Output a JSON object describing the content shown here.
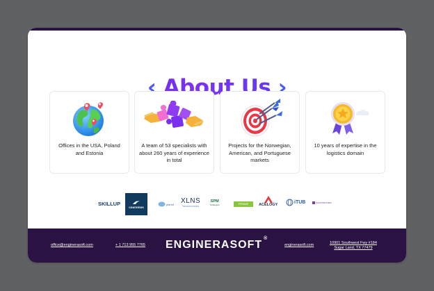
{
  "title": {
    "left_chevron": "‹",
    "text": "About Us",
    "right_chevron": "›"
  },
  "features": [
    {
      "icon": "globe-icon",
      "text": "Offices in the USA, Poland and Estonia"
    },
    {
      "icon": "puzzle-icon",
      "text": "A team of 53 specialists with about 260 years of experience in total"
    },
    {
      "icon": "target-icon",
      "text": "Projects for the Norwegian, American, and Portuguese markets"
    },
    {
      "icon": "medal-icon",
      "text": "10 years of expertise in the logistics domain"
    }
  ],
  "logos": {
    "skillup": "SKILLUP",
    "coursmos": "coursmos",
    "planet": "planet",
    "xlns": "XLNS",
    "xlns_sub": "TECHNOLOGIES",
    "spm": "SPM",
    "spm_sub": "Strategies",
    "green": "PIRAMIS",
    "acelogy": "ACELOGY",
    "itub": "iTUB",
    "paintpartner": "PAINTPARTNER"
  },
  "footer": {
    "email": "office@enginerasoft.com",
    "phone": "+ 1 713 955 7765",
    "brand": "ENGINERASOFT",
    "reg": "®",
    "website": "enginerasoft.com",
    "address_line1": "10901 Southwest Fwy #184",
    "address_line2": "Sugar Land, TX 77479"
  },
  "colors": {
    "accent_purple": "#6a2cf0",
    "footer_bg": "#2a1242",
    "backdrop": "#5f6163"
  }
}
